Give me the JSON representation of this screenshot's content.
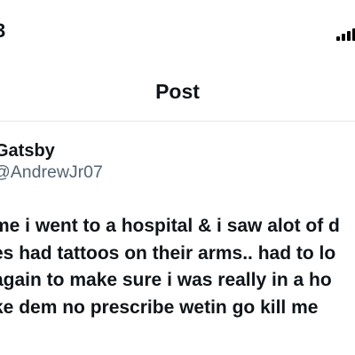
{
  "status_bar": {
    "time_fragment": "3"
  },
  "header": {
    "title": "Post"
  },
  "author": {
    "name": "Gatsby",
    "handle": "@AndrewJr07"
  },
  "post": {
    "lines": [
      "me i went to a hospital & i saw alot of d",
      "es had tattoos on their arms.. had to lo",
      "again to make sure i was really in a ho",
      "ke dem no prescribe wetin go kill me"
    ]
  }
}
